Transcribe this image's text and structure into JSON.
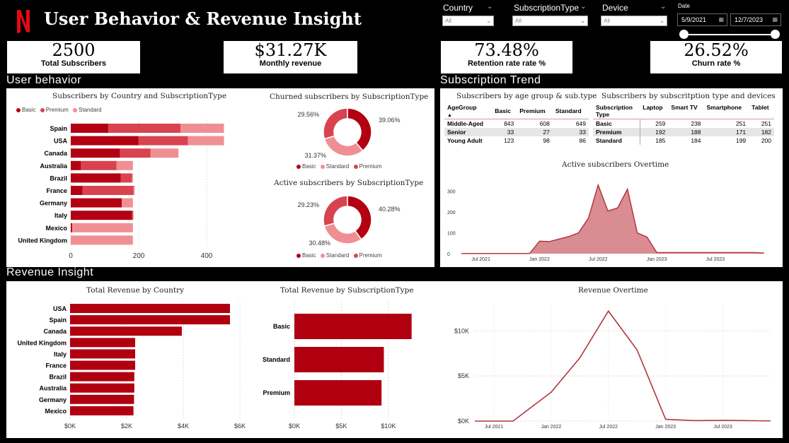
{
  "header": {
    "title": "User Behavior & Revenue Insight",
    "logo_letter": "N"
  },
  "filters": {
    "country": {
      "label": "Country",
      "value": "All"
    },
    "subscription_type": {
      "label": "SubscriptionType",
      "value": "All"
    },
    "device": {
      "label": "Device",
      "value": "All"
    },
    "date": {
      "label": "Date",
      "start": "5/9/2021",
      "end": "12/7/2023"
    }
  },
  "kpis": [
    {
      "value": "2500",
      "label": "Total Subscribers"
    },
    {
      "value": "$31.27K",
      "label": "Monthly revenue"
    },
    {
      "value": "73.48%",
      "label": "Retention rate rate %"
    },
    {
      "value": "26.52%",
      "label": "Churn rate %"
    }
  ],
  "sections": {
    "user_behavior": "User behavior",
    "subscription_trend": "Subscription Trend",
    "revenue_insight": "Revenue Insight"
  },
  "colors": {
    "basic": "#b30012",
    "premium": "#d94350",
    "standard": "#f08f93",
    "revenue_bar": "#b0000f",
    "area_fill": "#d98d92",
    "area_line": "#b3363f"
  },
  "legend_labels": {
    "basic": "Basic",
    "premium": "Premium",
    "standard": "Standard"
  },
  "tables": {
    "age_group": {
      "title": "Subscribers by age group & sub.type",
      "headers": [
        "AgeGroup",
        "Basic",
        "Premium",
        "Standard"
      ],
      "rows": [
        [
          "Middle-Aged",
          "843",
          "608",
          "649"
        ],
        [
          "Senior",
          "33",
          "27",
          "33"
        ],
        [
          "Young Adult",
          "123",
          "98",
          "86"
        ]
      ]
    },
    "devices": {
      "title": "Subscribers by subscritption type and devices",
      "header_first": "Subscription",
      "header_first_line2": "Type",
      "headers": [
        "Laptop",
        "Smart TV",
        "Smartphone",
        "Tablet"
      ],
      "rows": [
        [
          "Basic",
          "259",
          "238",
          "251",
          "251"
        ],
        [
          "Premium",
          "192",
          "188",
          "171",
          "182"
        ],
        [
          "Standard",
          "185",
          "184",
          "199",
          "200"
        ]
      ]
    }
  },
  "chart_data": [
    {
      "id": "country_stacked",
      "type": "bar",
      "title": "Subscribers by Country and SubscriptionType",
      "categories": [
        "Spain",
        "USA",
        "Canada",
        "Australia",
        "Brazil",
        "France",
        "Germany",
        "Italy",
        "Mexico",
        "United Kingdom"
      ],
      "series": [
        {
          "name": "Basic",
          "values": [
            111,
            199,
            145,
            30,
            147,
            35,
            150,
            180,
            4,
            0
          ]
        },
        {
          "name": "Premium",
          "values": [
            212,
            146,
            90,
            105,
            33,
            150,
            0,
            4,
            0,
            0
          ]
        },
        {
          "name": "Standard",
          "values": [
            128,
            106,
            82,
            48,
            3,
            3,
            33,
            0,
            179,
            183
          ]
        }
      ],
      "xticks": [
        "0",
        "200",
        "400"
      ],
      "xlim": [
        0,
        460
      ],
      "legend": "top-left"
    },
    {
      "id": "churned_donut",
      "type": "pie",
      "title": "Churned subscribers by SubscriptionType",
      "slices": [
        {
          "name": "Basic",
          "value": 39.06,
          "label": "39.06%"
        },
        {
          "name": "Standard",
          "value": 31.37,
          "label": "31.37%"
        },
        {
          "name": "Premium",
          "value": 29.56,
          "label": "29.56%"
        }
      ],
      "legend": "bottom"
    },
    {
      "id": "active_donut",
      "type": "pie",
      "title": "Active subscribers by SubscriptionType",
      "slices": [
        {
          "name": "Basic",
          "value": 40.28,
          "label": "40.28%"
        },
        {
          "name": "Standard",
          "value": 30.48,
          "label": "30.48%"
        },
        {
          "name": "Premium",
          "value": 29.23,
          "label": "29.23%"
        }
      ],
      "legend": "bottom"
    },
    {
      "id": "active_overtime",
      "type": "area",
      "title": "Active subscribers Overtime",
      "x": [
        "2021-05",
        "2021-06",
        "2021-07",
        "2021-08",
        "2021-09",
        "2021-10",
        "2021-11",
        "2021-12",
        "2022-01",
        "2022-02",
        "2022-03",
        "2022-04",
        "2022-05",
        "2022-06",
        "2022-07",
        "2022-08",
        "2022-09",
        "2022-10",
        "2022-11",
        "2022-12",
        "2023-01",
        "2023-02",
        "2023-03",
        "2023-04",
        "2023-05",
        "2023-06",
        "2023-07",
        "2023-08",
        "2023-09",
        "2023-10",
        "2023-11",
        "2023-12"
      ],
      "values": [
        1,
        1,
        1,
        1,
        1,
        1,
        1,
        1,
        60,
        58,
        70,
        82,
        100,
        170,
        330,
        205,
        220,
        310,
        100,
        80,
        5,
        5,
        5,
        5,
        5,
        5,
        5,
        5,
        5,
        5,
        5,
        3
      ],
      "xticks": [
        "Jul 2021",
        "Jan 2022",
        "Jul 2022",
        "Jan 2023",
        "Jul 2023"
      ],
      "yticks": [
        "0",
        "100",
        "200",
        "300"
      ],
      "ylim": [
        0,
        360
      ]
    },
    {
      "id": "revenue_country",
      "type": "bar",
      "title": "Total Revenue by Country",
      "categories": [
        "USA",
        "Spain",
        "Canada",
        "United Kingdom",
        "Italy",
        "France",
        "Brazil",
        "Australia",
        "Germany",
        "Mexico"
      ],
      "values": [
        5650,
        5650,
        3950,
        2300,
        2300,
        2300,
        2270,
        2270,
        2260,
        2240
      ],
      "xticks": [
        "$0K",
        "$2K",
        "$4K",
        "$6K"
      ],
      "xlim": [
        0,
        6000
      ]
    },
    {
      "id": "revenue_subtype",
      "type": "bar",
      "title": "Total Revenue by SubscriptionType",
      "categories": [
        "Basic",
        "Standard",
        "Premium"
      ],
      "values": [
        12470,
        9520,
        9270
      ],
      "xticks": [
        "$0K",
        "$5K",
        "$10K"
      ],
      "xlim": [
        0,
        14000
      ]
    },
    {
      "id": "revenue_overtime",
      "type": "line",
      "title": "Revenue Overtime",
      "x": [
        "2021-05",
        "2021-09",
        "2022-01",
        "2022-04",
        "2022-07",
        "2022-10",
        "2023-01",
        "2023-04",
        "2023-07",
        "2023-12"
      ],
      "values": [
        0,
        0,
        3200,
        7000,
        12200,
        7900,
        200,
        50,
        80,
        20
      ],
      "xticks": [
        "Jul 2021",
        "Jan 2022",
        "Jul 2022",
        "Jan 2023",
        "Jul 2023"
      ],
      "yticks": [
        "$0K",
        "$5K",
        "$10K"
      ],
      "ylim": [
        0,
        13000
      ]
    }
  ]
}
